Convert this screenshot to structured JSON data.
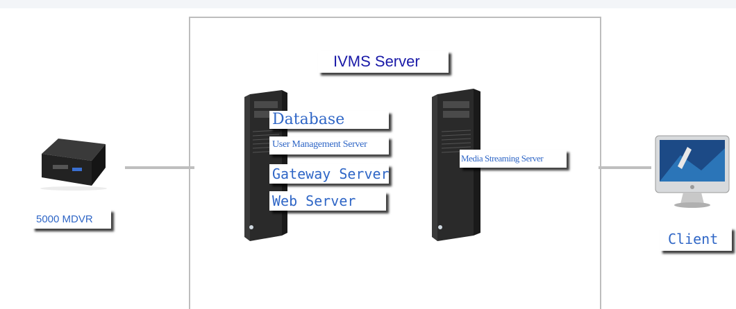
{
  "diagram": {
    "server_group": {
      "title": "IVMS Server"
    },
    "server1_modules": [
      "Database",
      "User Management Server",
      "Gateway Server",
      "Web Server"
    ],
    "server2_modules": [
      "Media Streaming Server"
    ],
    "device": {
      "label": "5000 MDVR",
      "icon": "dvr-device-icon"
    },
    "client": {
      "label": "Client",
      "icon": "imac-computer-icon"
    },
    "server_icon": "tower-server-icon",
    "colors": {
      "label_text": "#2f66c6",
      "title_text": "#1a1aa8",
      "connector": "#bfbfbf",
      "frame": "#bdbdbd"
    }
  }
}
